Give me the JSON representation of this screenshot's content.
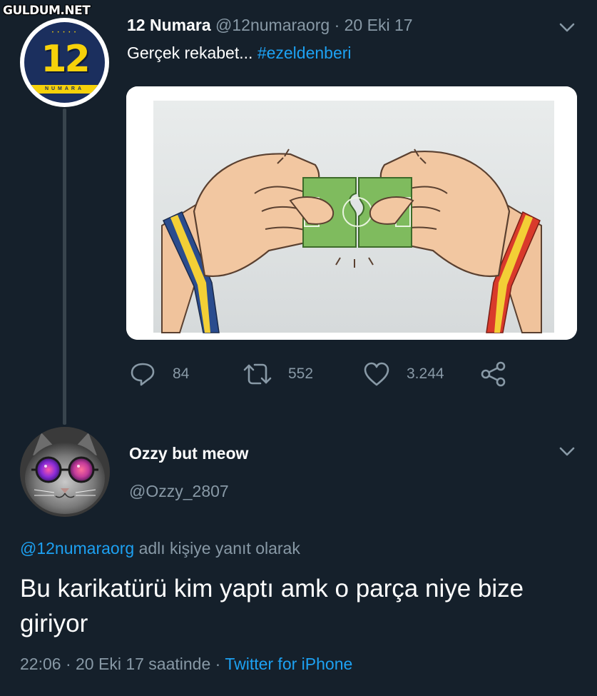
{
  "watermark": "GULDUM.NET",
  "colors": {
    "background": "#15202b",
    "secondary_text": "#8899a6",
    "link": "#1da1f2",
    "thread_line": "#38444d"
  },
  "tweet": {
    "avatar": {
      "number": "12",
      "ribbon_text": "NUMARA",
      "stars": "• • • • •"
    },
    "author_name": "12 Numara",
    "author_handle": "@12numaraorg",
    "separator": "·",
    "date": "20 Eki 17",
    "text": "Gerçek rekabet...",
    "hashtag": "#ezeldenberi",
    "media_icon": "cartoon-two-hands-puzzle-football-pitch",
    "actions": {
      "replies": "84",
      "retweets": "552",
      "likes": "3.244"
    },
    "icons": {
      "reply": "reply-icon",
      "retweet": "retweet-icon",
      "like": "heart-icon",
      "share": "share-icon",
      "more": "chevron-down-icon"
    }
  },
  "reply": {
    "author_name": "Ozzy but meow",
    "author_handle": "@Ozzy_2807",
    "replying_to_mention": "@12numaraorg",
    "replying_to_suffix": "adlı kişiye yanıt olarak",
    "text": "Bu karikatürü kim yaptı amk o parça niye bize giriyor",
    "time": "22:06",
    "date": "20 Eki 17 saatinde",
    "separator": "·",
    "source": "Twitter for iPhone"
  }
}
